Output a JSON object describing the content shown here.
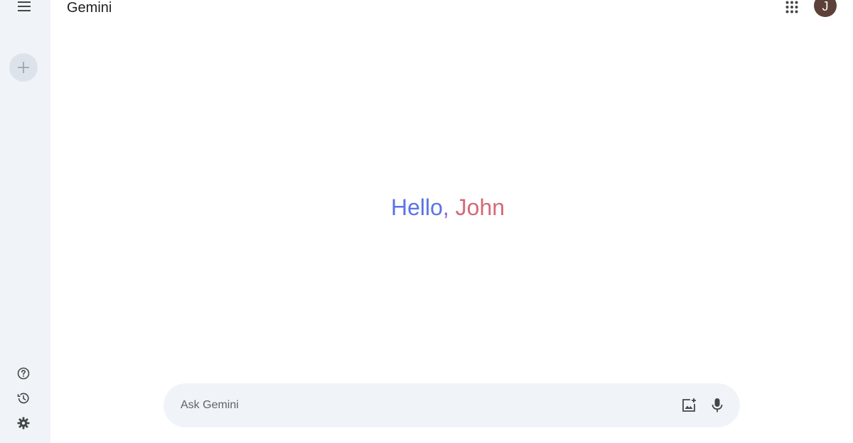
{
  "header": {
    "title": "Gemini",
    "avatar_initial": "J"
  },
  "greeting": {
    "hello": "Hello",
    "comma": ",",
    "name": "John"
  },
  "prompt": {
    "placeholder": "Ask Gemini",
    "value": ""
  },
  "icons": {
    "menu": "menu-icon",
    "new_chat": "plus-icon",
    "help": "help-icon",
    "activity": "history-icon",
    "settings": "gear-icon",
    "apps": "apps-grid-icon",
    "image_upload": "add-image-icon",
    "mic": "microphone-icon"
  },
  "colors": {
    "sidebar_bg": "#f0f4f9",
    "avatar_bg": "#5d4037",
    "greeting_start": "#5b74e6",
    "greeting_end": "#d36a77"
  }
}
